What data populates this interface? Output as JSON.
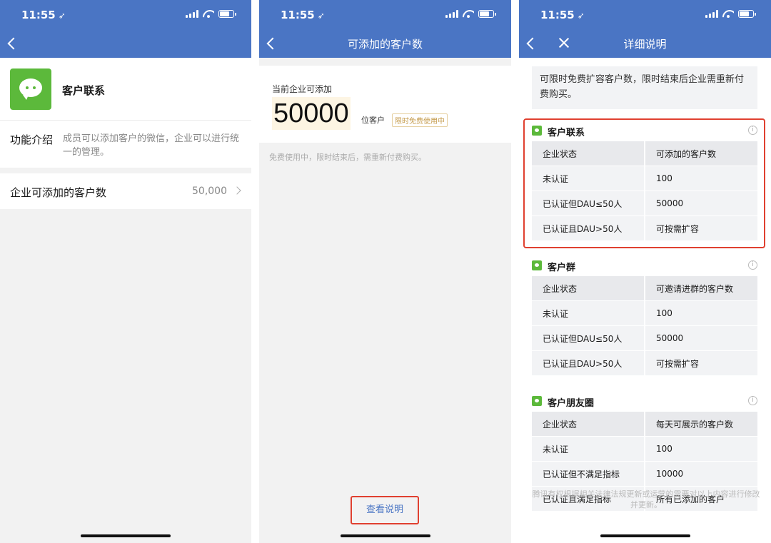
{
  "status": {
    "time": "11:55",
    "arrow": "➶"
  },
  "panel1": {
    "app_name": "客户联系",
    "intro_label": "功能介绍",
    "intro_text": "成员可以添加客户的微信，企业可以进行统一的管理。",
    "limit_label": "企业可添加的客户数",
    "limit_value": "50,000",
    "accent_color": "#4a75c4",
    "logo_color": "#5cb93b"
  },
  "panel2": {
    "title": "可添加的客户数",
    "quota_label": "当前企业可添加",
    "quota_number": "50000",
    "quota_unit": "位客户",
    "badge": "限时免费使用中",
    "note": "免费使用中，限时结束后，需重新付费购买。",
    "view_button": "查看说明"
  },
  "panel3": {
    "title": "详细说明",
    "notice": "可限时免费扩容客户数，限时结束后企业需重新付费购买。",
    "sections": [
      {
        "title": "客户联系",
        "icon": "chat-icon",
        "header": [
          "企业状态",
          "可添加的客户数"
        ],
        "rows": [
          [
            "未认证",
            "100"
          ],
          [
            "已认证但DAU≤50人",
            "50000"
          ],
          [
            "已认证且DAU>50人",
            "可按需扩容"
          ]
        ]
      },
      {
        "title": "客户群",
        "icon": "group-icon",
        "header": [
          "企业状态",
          "可邀请进群的客户数"
        ],
        "rows": [
          [
            "未认证",
            "100"
          ],
          [
            "已认证但DAU≤50人",
            "50000"
          ],
          [
            "已认证且DAU>50人",
            "可按需扩容"
          ]
        ]
      },
      {
        "title": "客户朋友圈",
        "icon": "moments-icon",
        "header": [
          "企业状态",
          "每天可展示的客户数"
        ],
        "rows": [
          [
            "未认证",
            "100"
          ],
          [
            "已认证但不满足指标",
            "10000"
          ],
          [
            "已认证且满足指标",
            "所有已添加的客户"
          ]
        ]
      }
    ],
    "footer_note": "腾讯有权根据相关法律法规更新或运营的需要对以上内容进行修改并更新。"
  }
}
